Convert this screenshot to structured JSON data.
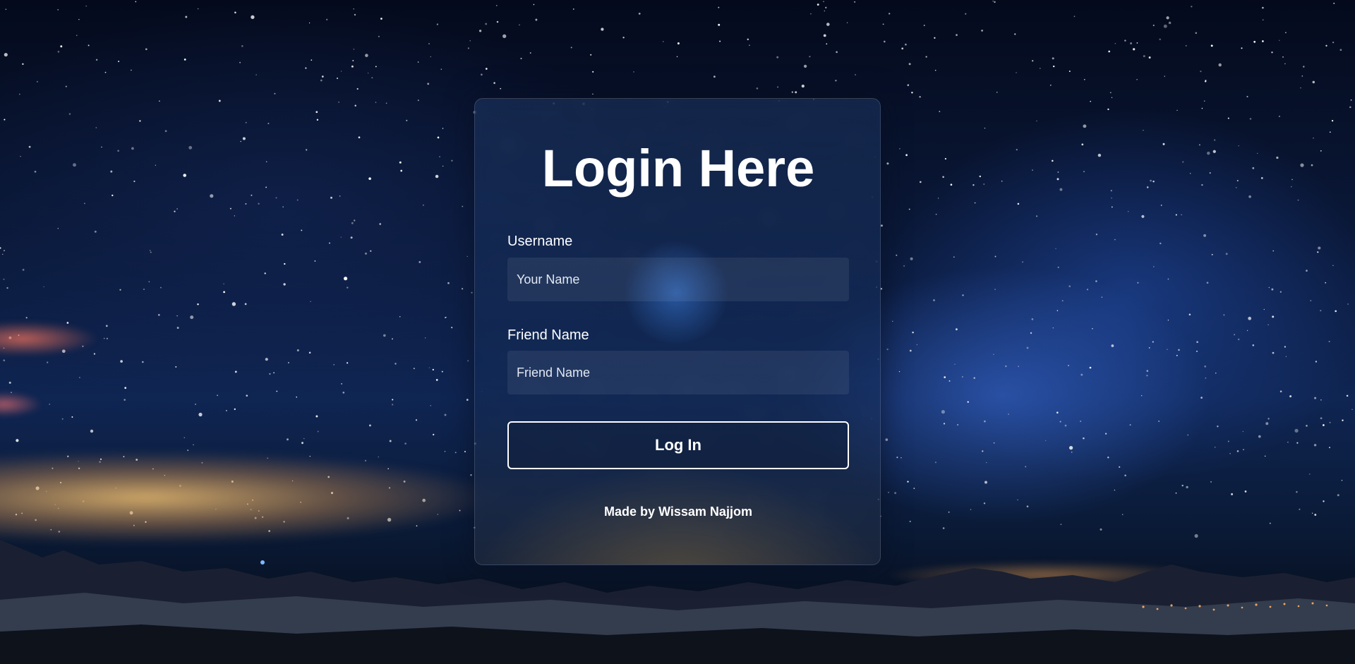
{
  "form": {
    "title": "Login Here",
    "username": {
      "label": "Username",
      "placeholder": "Your Name"
    },
    "friend": {
      "label": "Friend Name",
      "placeholder": "Friend Name"
    },
    "submit_label": "Log In",
    "credit": "Made by Wissam Najjom"
  },
  "colors": {
    "text": "#ffffff",
    "sky_top": "#040a1c",
    "sky_mid": "#0f2552",
    "milky_way": "#3c6edc",
    "cloud_glow": "#f0be6e"
  },
  "background": {
    "scene": "starry-night-sky-over-snowy-mountains"
  }
}
